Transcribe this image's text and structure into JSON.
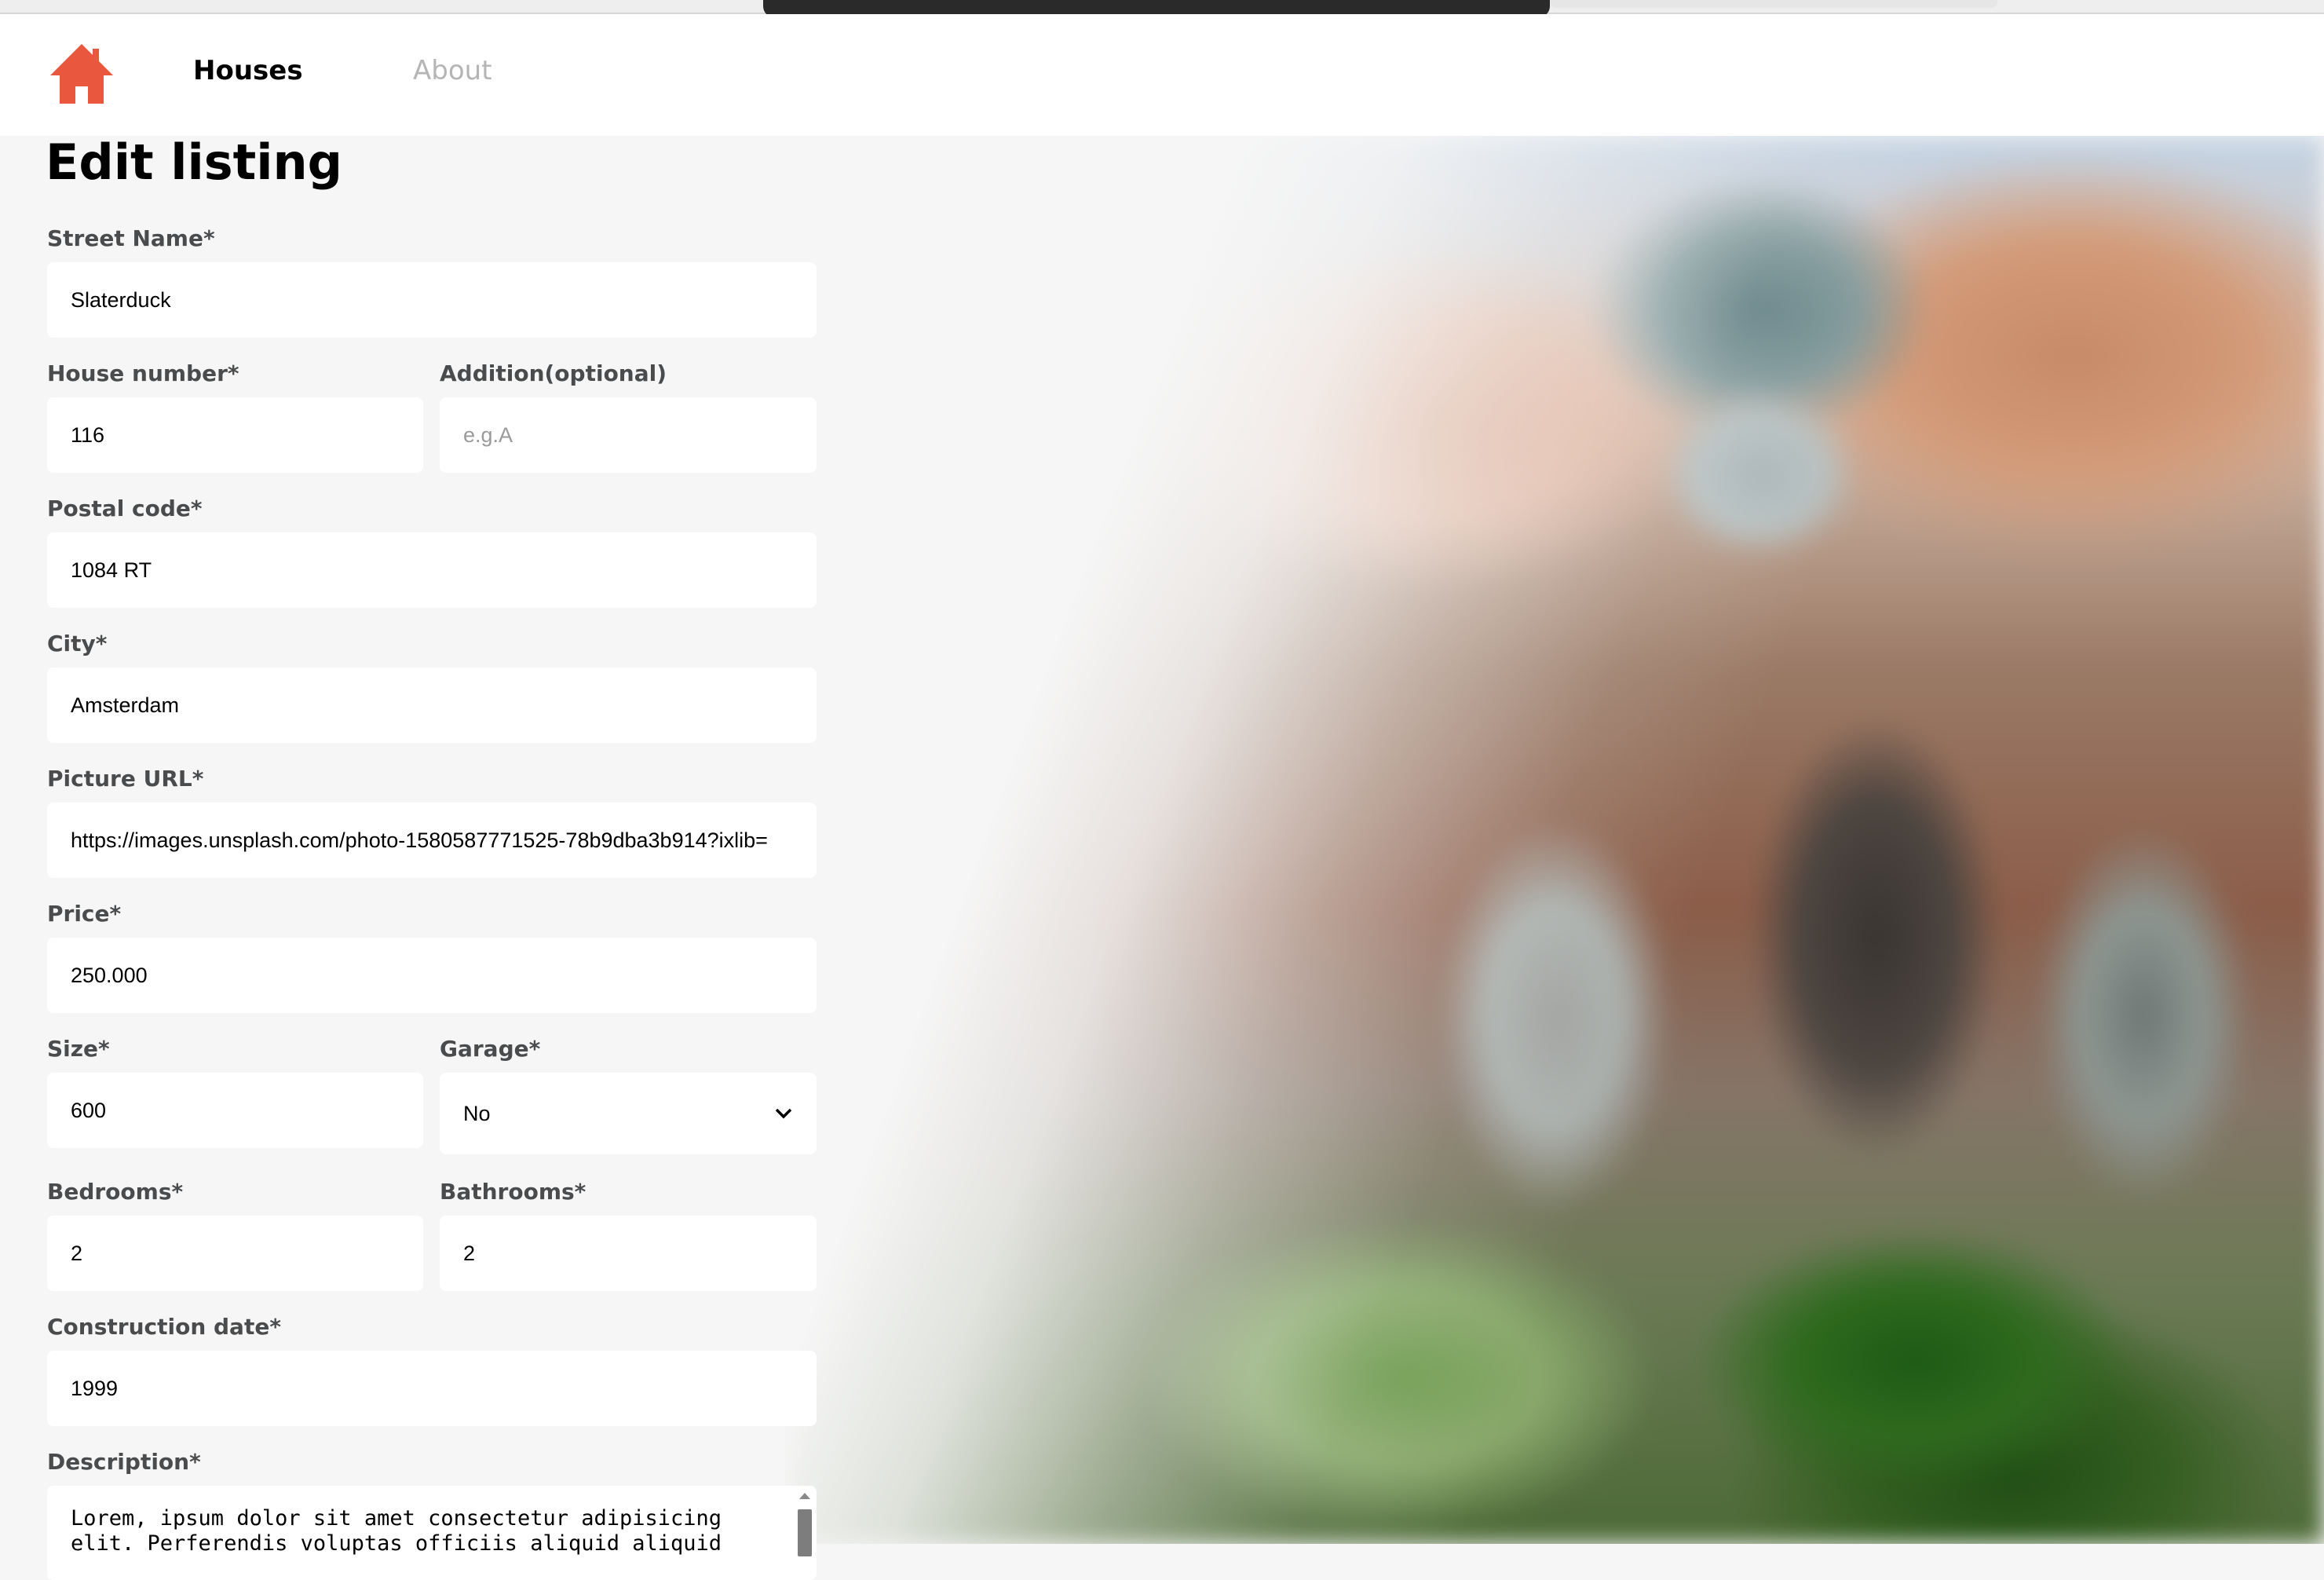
{
  "nav": {
    "houses_label": "Houses",
    "about_label": "About",
    "brand_color": "#e9573f"
  },
  "page": {
    "title": "Edit listing"
  },
  "form": {
    "street_name": {
      "label": "Street Name*",
      "value": "Slaterduck"
    },
    "house_number": {
      "label": "House number*",
      "value": "116"
    },
    "addition": {
      "label": "Addition(optional)",
      "value": "",
      "placeholder": "e.g.A"
    },
    "postal_code": {
      "label": "Postal code*",
      "value": "1084 RT"
    },
    "city": {
      "label": "City*",
      "value": "Amsterdam"
    },
    "picture_url": {
      "label": "Picture URL*",
      "value": "https://images.unsplash.com/photo-1580587771525-78b9dba3b914?ixlib="
    },
    "price": {
      "label": "Price*",
      "value": "250.000"
    },
    "size": {
      "label": "Size*",
      "value": "600"
    },
    "garage": {
      "label": "Garage*",
      "value": "No"
    },
    "bedrooms": {
      "label": "Bedrooms*",
      "value": "2"
    },
    "bathrooms": {
      "label": "Bathrooms*",
      "value": "2"
    },
    "construction_date": {
      "label": "Construction date*",
      "value": "1999"
    },
    "description": {
      "label": "Description*",
      "value": "Lorem, ipsum dolor sit amet consectetur adipisicing elit. Perferendis voluptas officiis aliquid aliquid"
    }
  },
  "icons": {
    "logo": "house-icon",
    "select_arrow": "chevron-down-icon",
    "scroll_up": "scroll-up-arrow-icon"
  }
}
